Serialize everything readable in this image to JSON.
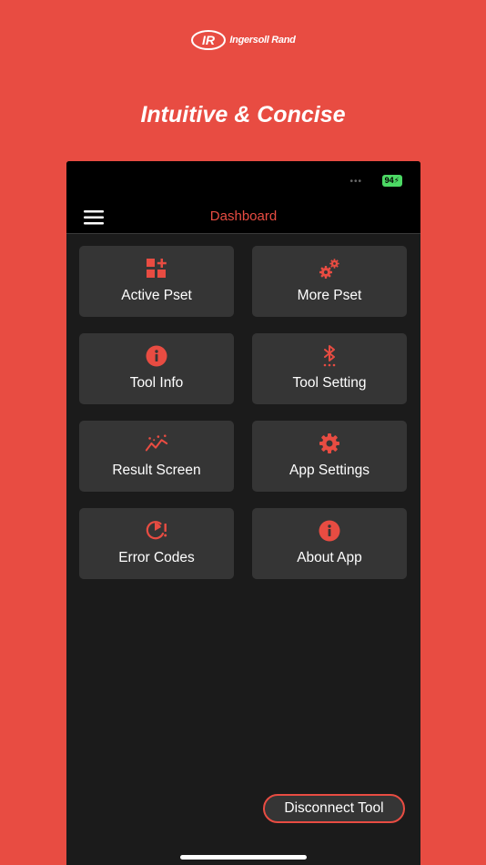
{
  "brand": {
    "logo_mark": "IR",
    "name": "Ingersoll Rand"
  },
  "headline": "Intuitive & Concise",
  "status_bar": {
    "battery": "94"
  },
  "app_bar": {
    "title": "Dashboard",
    "menu_icon": "hamburger-menu-icon"
  },
  "tiles": [
    {
      "label": "Active Pset",
      "icon": "grid-add-icon"
    },
    {
      "label": "More Pset",
      "icon": "gears-icon"
    },
    {
      "label": "Tool Info",
      "icon": "info-icon"
    },
    {
      "label": "Tool Setting",
      "icon": "bluetooth-settings-icon"
    },
    {
      "label": "Result Screen",
      "icon": "trend-line-icon"
    },
    {
      "label": "App Settings",
      "icon": "gear-icon"
    },
    {
      "label": "Error Codes",
      "icon": "timer-alert-icon"
    },
    {
      "label": "About App",
      "icon": "info-icon"
    }
  ],
  "disconnect_button": {
    "label": "Disconnect Tool"
  },
  "colors": {
    "accent": "#e84c42",
    "screen_background": "#1b1b1b",
    "tile_background": "#353535",
    "bar_background": "#000000",
    "battery": "#4cd964"
  }
}
